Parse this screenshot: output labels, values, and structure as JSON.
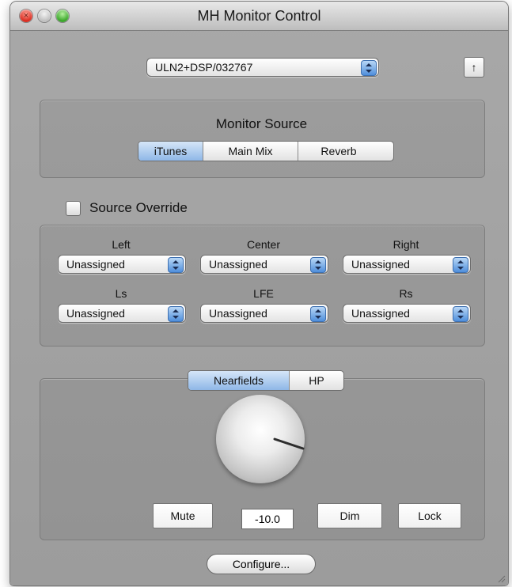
{
  "window": {
    "title": "MH Monitor Control",
    "traffic_lights": {
      "close_glyph": "×"
    }
  },
  "device": {
    "selected": "ULN2+DSP/032767",
    "upload_icon": "arrow-up-icon",
    "upload_glyph": "↑"
  },
  "monitor_source": {
    "title": "Monitor Source",
    "options": [
      "iTunes",
      "Main Mix",
      "Reverb"
    ],
    "selected_index": 0
  },
  "source_override": {
    "label": "Source Override",
    "checked": false
  },
  "channels": [
    {
      "label": "Left",
      "value": "Unassigned"
    },
    {
      "label": "Center",
      "value": "Unassigned"
    },
    {
      "label": "Right",
      "value": "Unassigned"
    },
    {
      "label": "Ls",
      "value": "Unassigned"
    },
    {
      "label": "LFE",
      "value": "Unassigned"
    },
    {
      "label": "Rs",
      "value": "Unassigned"
    }
  ],
  "output": {
    "tabs": [
      "Nearfields",
      "HP"
    ],
    "selected_index": 0,
    "mute_label": "Mute",
    "level_value": "-10.0",
    "dim_label": "Dim",
    "lock_label": "Lock"
  },
  "configure_label": "Configure...",
  "colors": {
    "selected_segment": "#8fb7e7",
    "window_bg": "#a3a3a3"
  }
}
